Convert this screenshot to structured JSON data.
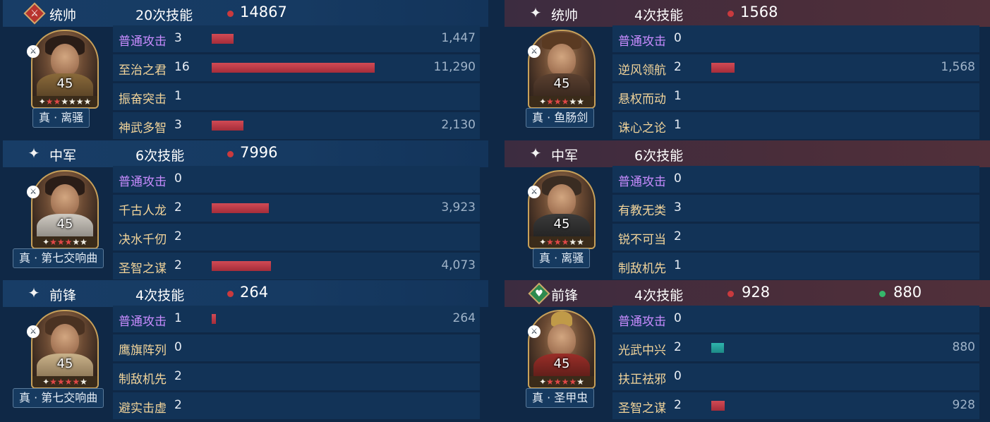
{
  "colors": {
    "bar_red": "#c23a46",
    "bar_teal": "#26a29d",
    "header_left": "#183d66",
    "header_right": "#4a2d3a",
    "skill_basic": "#c98cff",
    "skill_gold": "#f2d49a"
  },
  "left": [
    {
      "role": "统帅",
      "role_icon": "sword-icon",
      "skill_count": "20次技能",
      "damage": "14867",
      "level": "45",
      "stars": {
        "red": 2,
        "white": 4
      },
      "weapon": "真 · 离骚",
      "skills": [
        {
          "name": "普通攻击",
          "count": "3",
          "value": "1,447",
          "fill": 0.06
        },
        {
          "name": "至治之君",
          "count": "16",
          "value": "11,290",
          "fill": 0.45
        },
        {
          "name": "振奋突击",
          "count": "1",
          "value": "",
          "fill": 0
        },
        {
          "name": "神武多智",
          "count": "3",
          "value": "2,130",
          "fill": 0.09
        }
      ]
    },
    {
      "role": "中军",
      "role_icon": "sparkle-icon",
      "skill_count": "6次技能",
      "damage": "7996",
      "level": "45",
      "stars": {
        "red": 3,
        "white": 2
      },
      "weapon": "真 · 第七交响曲",
      "skills": [
        {
          "name": "普通攻击",
          "count": "0",
          "value": "",
          "fill": 0
        },
        {
          "name": "千古人龙",
          "count": "2",
          "value": "3,923",
          "fill": 0.16
        },
        {
          "name": "决水千仞",
          "count": "2",
          "value": "",
          "fill": 0
        },
        {
          "name": "圣智之谋",
          "count": "2",
          "value": "4,073",
          "fill": 0.165
        }
      ]
    },
    {
      "role": "前锋",
      "role_icon": "sparkle-icon",
      "skill_count": "4次技能",
      "damage": "264",
      "level": "45",
      "stars": {
        "red": 4,
        "white": 1
      },
      "weapon": "真 · 第七交响曲",
      "skills": [
        {
          "name": "普通攻击",
          "count": "1",
          "value": "264",
          "fill": 0.012
        },
        {
          "name": "鹰旗阵列",
          "count": "0",
          "value": "",
          "fill": 0
        },
        {
          "name": "制敌机先",
          "count": "2",
          "value": "",
          "fill": 0
        },
        {
          "name": "避实击虚",
          "count": "2",
          "value": "",
          "fill": 0
        }
      ]
    }
  ],
  "right": [
    {
      "role": "统帅",
      "role_icon": "sparkle-icon",
      "skill_count": "4次技能",
      "damage": "1568",
      "heal": "",
      "level": "45",
      "stars": {
        "red": 3,
        "white": 2
      },
      "weapon": "真 · 鱼肠剑",
      "skills": [
        {
          "name": "普通攻击",
          "count": "0",
          "value": "",
          "fill": 0
        },
        {
          "name": "逆风领航",
          "count": "2",
          "value": "1,568",
          "fill": 0.065,
          "color": "red"
        },
        {
          "name": "悬权而动",
          "count": "1",
          "value": "",
          "fill": 0
        },
        {
          "name": "诛心之论",
          "count": "1",
          "value": "",
          "fill": 0
        }
      ]
    },
    {
      "role": "中军",
      "role_icon": "sparkle-icon",
      "skill_count": "6次技能",
      "damage": "",
      "heal": "",
      "level": "45",
      "stars": {
        "red": 3,
        "white": 2
      },
      "weapon": "真 · 离骚",
      "skills": [
        {
          "name": "普通攻击",
          "count": "0",
          "value": "",
          "fill": 0
        },
        {
          "name": "有教无类",
          "count": "3",
          "value": "",
          "fill": 0
        },
        {
          "name": "锐不可当",
          "count": "2",
          "value": "",
          "fill": 0
        },
        {
          "name": "制敌机先",
          "count": "1",
          "value": "",
          "fill": 0
        }
      ]
    },
    {
      "role": "前锋",
      "role_icon": "heart-icon",
      "skill_count": "4次技能",
      "damage": "928",
      "heal": "880",
      "level": "45",
      "stars": {
        "red": 4,
        "white": 1
      },
      "weapon": "真 · 圣甲虫",
      "skills": [
        {
          "name": "普通攻击",
          "count": "0",
          "value": "",
          "fill": 0
        },
        {
          "name": "光武中兴",
          "count": "2",
          "value": "880",
          "fill": 0.035,
          "color": "teal"
        },
        {
          "name": "扶正祛邪",
          "count": "0",
          "value": "",
          "fill": 0
        },
        {
          "name": "圣智之谋",
          "count": "2",
          "value": "928",
          "fill": 0.038,
          "color": "red"
        }
      ]
    }
  ]
}
